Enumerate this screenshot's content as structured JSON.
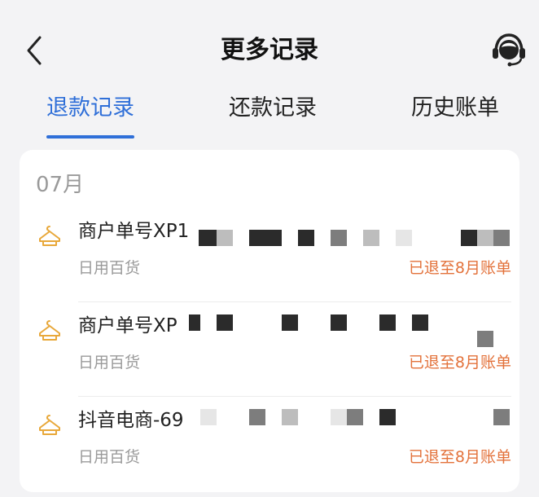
{
  "header": {
    "title": "更多记录",
    "back_icon": "chevron-left-icon",
    "service_icon": "customer-service-icon"
  },
  "tabs": [
    {
      "label": "退款记录",
      "active": true
    },
    {
      "label": "还款记录",
      "active": false
    },
    {
      "label": "历史账单",
      "active": false
    }
  ],
  "records": {
    "month": "07月",
    "items": [
      {
        "name": "商户单号XP1",
        "category": "日用百货",
        "status": "已退至8月账单",
        "icon": "hanger-icon"
      },
      {
        "name": "商户单号XP",
        "category": "日用百货",
        "status": "已退至8月账单",
        "icon": "hanger-icon"
      },
      {
        "name": "抖音电商-69",
        "category": "日用百货",
        "status": "已退至8月账单",
        "icon": "hanger-icon"
      }
    ]
  },
  "colors": {
    "accent": "#2f6fd8",
    "status": "#e3723b",
    "icon": "#e8a83a",
    "muted_text": "#9a9a9a"
  }
}
